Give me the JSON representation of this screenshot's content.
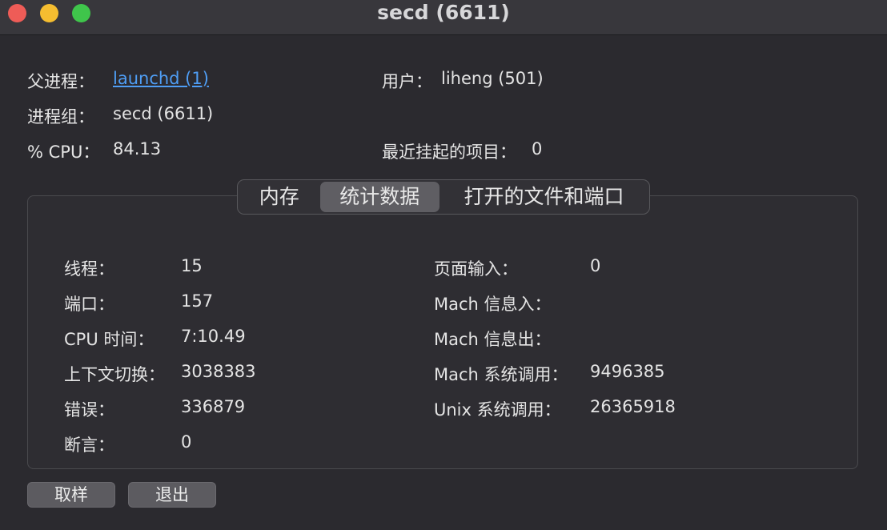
{
  "window": {
    "title": "secd (6611)"
  },
  "info": {
    "parent_label": "父进程：",
    "parent_value": "launchd (1)",
    "group_label": "进程组：",
    "group_value": "secd (6611)",
    "cpu_label": "% CPU：",
    "cpu_value": "84.13",
    "user_label": "用户：",
    "user_value": "liheng (501)",
    "hangs_label": "最近挂起的项目：",
    "hangs_value": "0"
  },
  "tabs": [
    {
      "label": "内存"
    },
    {
      "label": "统计数据"
    },
    {
      "label": "打开的文件和端口"
    }
  ],
  "stats": {
    "threads_label": "线程：",
    "threads_value": "15",
    "ports_label": "端口：",
    "ports_value": "157",
    "cputime_label": "CPU 时间：",
    "cputime_value": "7:10.49",
    "ctx_label": "上下文切换：",
    "ctx_value": "3038383",
    "faults_label": "错误：",
    "faults_value": "336879",
    "asserts_label": "断言：",
    "asserts_value": "0",
    "pagein_label": "页面输入：",
    "pagein_value": "0",
    "machin_label": "Mach 信息入：",
    "machin_value": "",
    "machout_label": "Mach 信息出：",
    "machout_value": "",
    "machsys_label": "Mach 系统调用：",
    "machsys_value": "9496385",
    "unixsys_label": "Unix 系统调用：",
    "unixsys_value": "26365918"
  },
  "buttons": {
    "sample": "取样",
    "quit": "退出"
  },
  "colors": {
    "background": "#2b2a2f",
    "link": "#4f9ef5",
    "close": "#ee5c57",
    "minimize": "#f5bd30",
    "maximize": "#3fc54b"
  }
}
